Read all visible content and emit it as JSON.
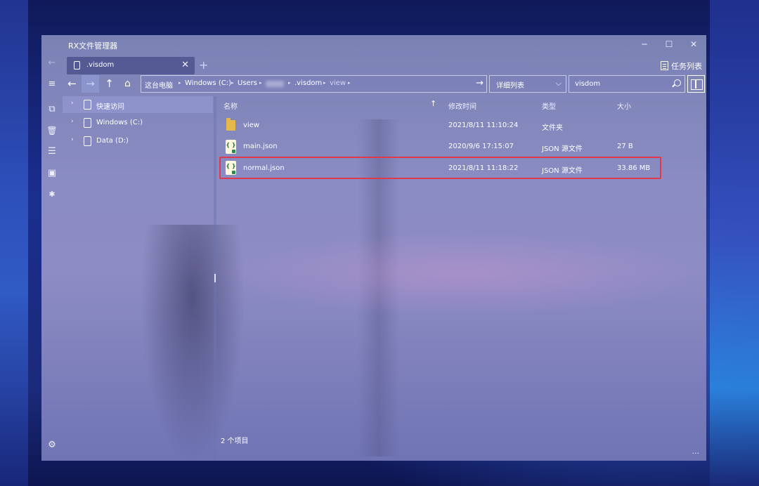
{
  "app": {
    "title": "RX文件管理器"
  },
  "window_controls": {
    "minimize": "─",
    "maximize": "☐",
    "close": "✕"
  },
  "rail": [
    {
      "name": "back-arrow-icon",
      "glyph": "←"
    },
    {
      "name": "hamburger-menu-icon",
      "glyph": "≡"
    },
    {
      "name": "devices-icon",
      "glyph": "⧉"
    },
    {
      "name": "trash-icon",
      "glyph": "🗑"
    },
    {
      "name": "list-icon",
      "glyph": "☰"
    },
    {
      "name": "file-tag-icon",
      "glyph": "▣"
    },
    {
      "name": "bluetooth-icon",
      "glyph": "✱"
    },
    {
      "name": "settings-gear-icon",
      "glyph": "⚙"
    }
  ],
  "tab": {
    "label": ".visdom",
    "close": "✕",
    "add": "+"
  },
  "task_list": {
    "label": "任务列表"
  },
  "nav": {
    "back": "←",
    "forward": "→",
    "up": "↑",
    "home": "⌂"
  },
  "address": {
    "crumbs": [
      "这台电脑",
      "Windows (C:)",
      "Users",
      ".visdom",
      "view"
    ],
    "sep": "▸",
    "go": "→"
  },
  "view_mode": {
    "label": "详细列表",
    "chevron": "⌵"
  },
  "search": {
    "value": "visdom"
  },
  "tree": [
    {
      "label": "快速访问",
      "chevron": "›"
    },
    {
      "label": "Windows (C:)",
      "chevron": "›"
    },
    {
      "label": "Data (D:)",
      "chevron": "›"
    }
  ],
  "columns": {
    "name": "名称",
    "sort": "↑",
    "modified": "修改时间",
    "type": "类型",
    "size": "大小"
  },
  "files": [
    {
      "name": "view",
      "modified": "2021/8/11 11:10:24",
      "type": "文件夹",
      "size": "",
      "kind": "folder"
    },
    {
      "name": "main.json",
      "modified": "2020/9/6 17:15:07",
      "type": "JSON 源文件",
      "size": "27 B",
      "kind": "json"
    },
    {
      "name": "normal.json",
      "modified": "2021/8/11 11:18:22",
      "type": "JSON 源文件",
      "size": "33.86 MB",
      "kind": "json",
      "highlight": "#e0394d"
    }
  ],
  "json_icon_text": "{ }",
  "status": {
    "count": "2 个项目"
  },
  "more": "···"
}
